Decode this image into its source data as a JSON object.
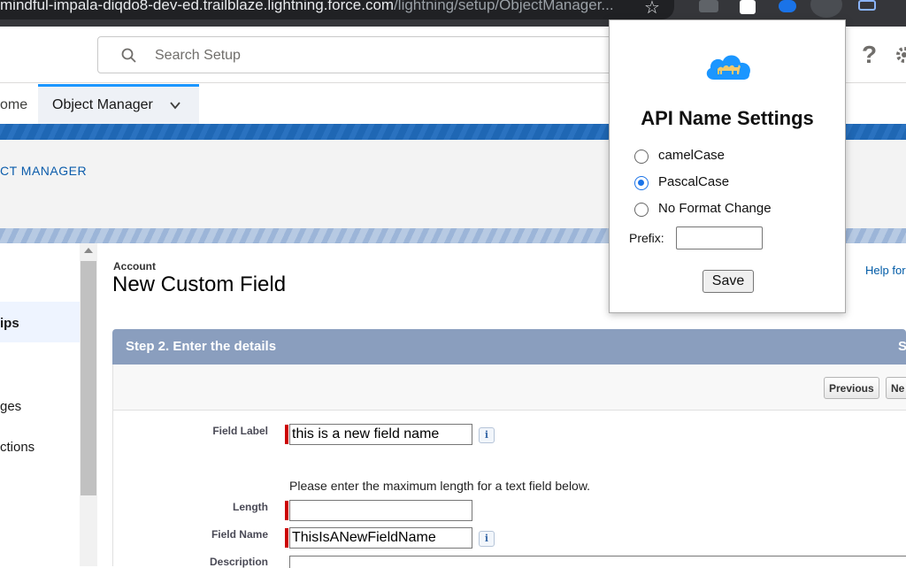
{
  "browser": {
    "url_host": "mindful-impala-diqdo8-dev-ed.trailblaze.lightning.force.com",
    "url_path": "/lightning/setup/ObjectManager..."
  },
  "header": {
    "search_placeholder": "Search Setup"
  },
  "nav": {
    "home_label": "ome",
    "object_manager_label": "Object Manager"
  },
  "breadcrumb": "CT MANAGER",
  "sidebar": {
    "items": [
      "ips",
      "ges",
      "ctions"
    ]
  },
  "page": {
    "object_label": "Account",
    "title": "New Custom Field",
    "help_link": "Help for",
    "step_title": "Step 2. Enter the details",
    "step_right": "S",
    "previous_button": "Previous",
    "next_button": "Ne"
  },
  "form": {
    "field_label_label": "Field Label",
    "field_label_value": "this is a new field name",
    "length_hint": "Please enter the maximum length for a text field below.",
    "length_label": "Length",
    "length_value": "",
    "field_name_label": "Field Name",
    "field_name_value": "ThisIsANewFieldName",
    "description_label": "Description",
    "info_glyph": "i"
  },
  "popup": {
    "title": "API Name Settings",
    "options": [
      "camelCase",
      "PascalCase",
      "No Format Change"
    ],
    "selected_option": "PascalCase",
    "prefix_label": "Prefix:",
    "prefix_value": "",
    "save_label": "Save"
  },
  "colors": {
    "brand_blue": "#1f67b4",
    "step_header": "#8a9ebe",
    "radio_selected": "#1a73e8",
    "required_marker": "#cc0000"
  }
}
